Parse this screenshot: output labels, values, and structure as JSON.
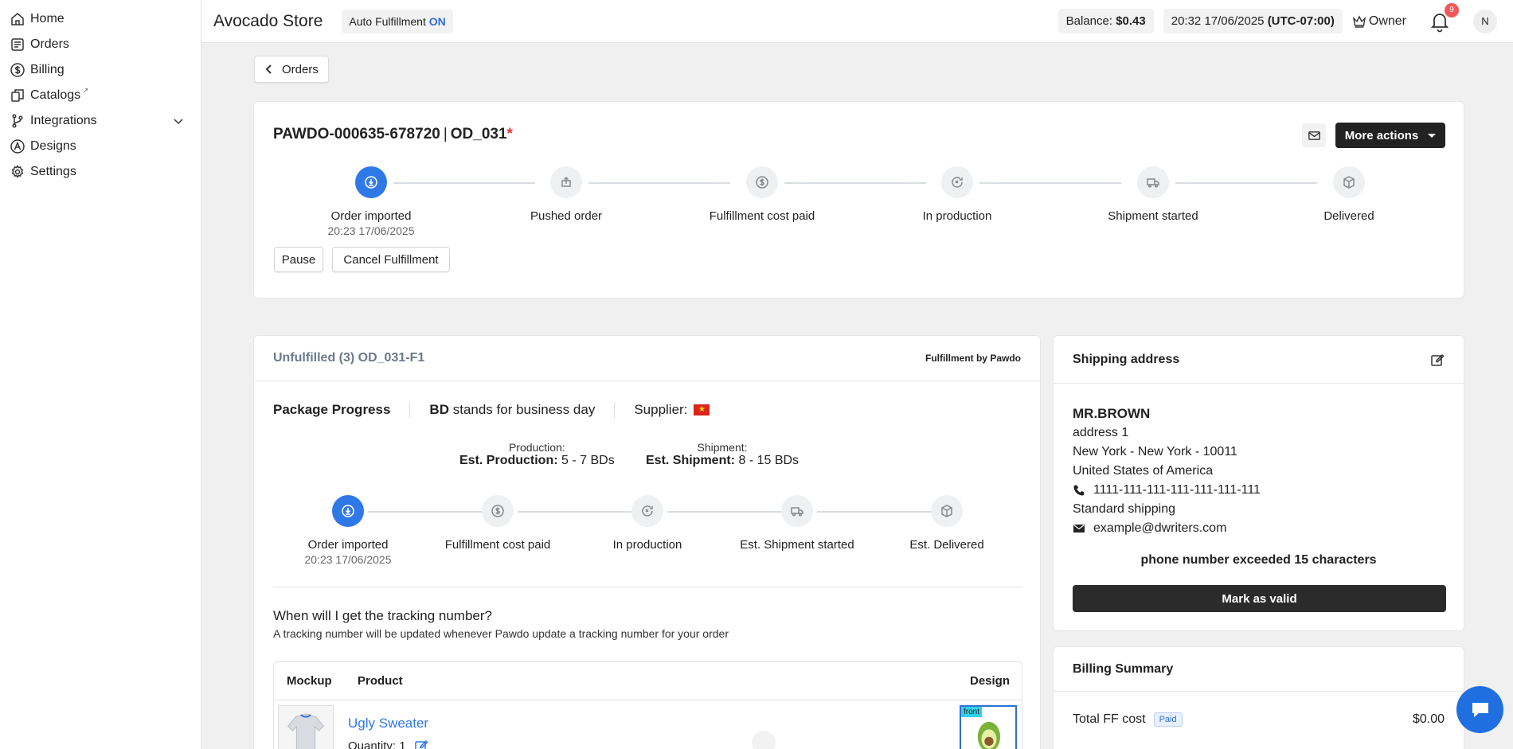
{
  "sidebar": {
    "items": [
      {
        "label": "Home",
        "icon": "home-icon"
      },
      {
        "label": "Orders",
        "icon": "orders-icon"
      },
      {
        "label": "Billing",
        "icon": "dollar-icon"
      },
      {
        "label": "Catalogs",
        "icon": "catalog-icon"
      },
      {
        "label": "Integrations",
        "icon": "branch-icon"
      },
      {
        "label": "Designs",
        "icon": "designs-icon"
      },
      {
        "label": "Settings",
        "icon": "gear-icon"
      }
    ]
  },
  "header": {
    "store_name": "Avocado Store",
    "auto_ff_label": "Auto Fulfillment",
    "auto_ff_state": "ON",
    "balance_label": "Balance:",
    "balance_value": "$0.43",
    "datetime": "20:32 17/06/2025",
    "timezone": "(UTC-07:00)",
    "role": "Owner",
    "notifications": "9",
    "avatar": "N"
  },
  "back_label": "Orders",
  "order": {
    "id": "PAWDO-000635-678720",
    "sep": "|",
    "name": "OD_031",
    "star": "*",
    "more_actions": "More actions",
    "steps": [
      {
        "label": "Order imported",
        "sub": "20:23 17/06/2025"
      },
      {
        "label": "Pushed order"
      },
      {
        "label": "Fulfillment cost paid"
      },
      {
        "label": "In production"
      },
      {
        "label": "Shipment started"
      },
      {
        "label": "Delivered"
      }
    ],
    "pause_label": "Pause",
    "cancel_label": "Cancel Fulfillment"
  },
  "fulfillment": {
    "title": "Unfulfilled (3) OD_031-F1",
    "by": "Fulfillment by Pawdo",
    "pkg_progress": "Package Progress",
    "bd": "BD",
    "bd_text": "stands for business day",
    "supplier": "Supplier:",
    "production_h": "Production:",
    "production_label": "Est. Production:",
    "production_val": "5 - 7 BDs",
    "shipment_h": "Shipment:",
    "shipment_label": "Est. Shipment:",
    "shipment_val": "8 - 15 BDs",
    "steps": [
      {
        "label": "Order imported",
        "sub": "20:23 17/06/2025"
      },
      {
        "label": "Fulfillment cost paid"
      },
      {
        "label": "In production"
      },
      {
        "label": "Est. Shipment started"
      },
      {
        "label": "Est. Delivered"
      }
    ],
    "track_q": "When will I get the tracking number?",
    "track_a": "A tracking number will be updated whenever Pawdo update a tracking number for your order",
    "table": {
      "col_mockup": "Mockup",
      "col_product": "Product",
      "col_design": "Design",
      "product_name": "Ugly Sweater",
      "quantity": "Quantity: 1",
      "design_tag": "front"
    }
  },
  "shipping": {
    "title": "Shipping address",
    "name": "MR.BROWN",
    "address1": "address 1",
    "city": "New York - New York - 10011",
    "country": "United States of America",
    "phone": "1111-111-111-111-111-111-111",
    "method": "Standard shipping",
    "email": "example@dwriters.com",
    "warning": "phone number exceeded 15 characters",
    "mark_valid": "Mark as valid"
  },
  "billing": {
    "title": "Billing Summary",
    "total_label": "Total FF cost",
    "status": "Paid",
    "amount": "$0.00"
  },
  "colors": {
    "accent": "#2f78e8",
    "dark": "#222222",
    "danger": "#e03a3a"
  }
}
